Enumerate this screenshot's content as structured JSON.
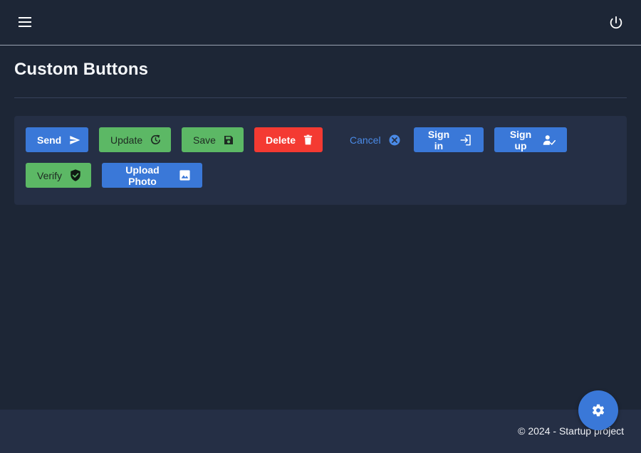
{
  "header": {
    "menu_icon": "hamburger-menu-icon",
    "power_icon": "power-icon"
  },
  "page": {
    "title": "Custom Buttons"
  },
  "buttons": {
    "send": {
      "label": "Send",
      "icon": "send-icon",
      "color": "#3a78d8"
    },
    "update": {
      "label": "Update",
      "icon": "refresh-icon",
      "color": "#5cb865"
    },
    "save": {
      "label": "Save",
      "icon": "floppy-disk-icon",
      "color": "#5cb865"
    },
    "delete": {
      "label": "Delete",
      "icon": "trash-icon",
      "color": "#f43a32"
    },
    "cancel": {
      "label": "Cancel",
      "icon": "close-circle-icon",
      "color": "#4a8ae6"
    },
    "sign_in": {
      "label": "Sign in",
      "icon": "login-icon",
      "color": "#3a78d8"
    },
    "sign_up": {
      "label": "Sign up",
      "icon": "user-check-icon",
      "color": "#3a78d8"
    },
    "verify": {
      "label": "Verify",
      "icon": "shield-check-icon",
      "color": "#5cb865"
    },
    "upload_photo": {
      "label": "Upload Photo",
      "icon": "image-icon",
      "color": "#3a78d8"
    }
  },
  "footer": {
    "copyright": "© 2024 - Startup project"
  },
  "fab": {
    "icon": "gear-icon",
    "color": "#3a78d8"
  }
}
